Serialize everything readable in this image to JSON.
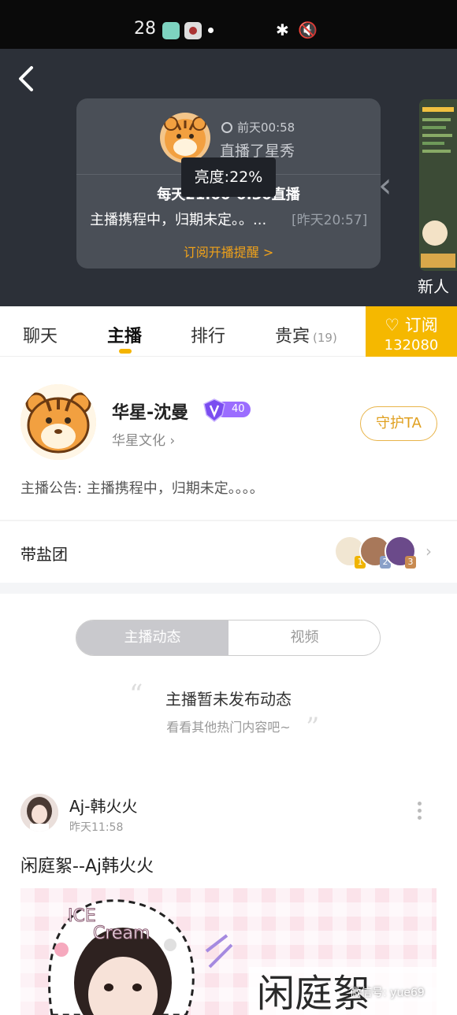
{
  "status_bar": {
    "time_fragment": "28",
    "bluetooth_icon": "bluetooth-icon",
    "mute_icon": "mute-icon"
  },
  "header": {
    "card": {
      "time": "前天00:58",
      "live_label": "直播了星秀",
      "schedule": "每天21:00-0:30直播",
      "notice": "主播携程中，归期未定。。...",
      "notice_time": "[昨天20:57]",
      "subscribe_link": "订阅开播提醒 >"
    },
    "tooltip": "亮度:22%",
    "side_label": "新人"
  },
  "tabs": {
    "items": [
      {
        "label": "聊天"
      },
      {
        "label": "主播"
      },
      {
        "label": "排行"
      },
      {
        "label": "贵宾",
        "count": "(19)"
      }
    ],
    "active_index": 1,
    "subscribe": {
      "label": "订阅",
      "count": "132080"
    }
  },
  "anchor": {
    "name": "华星-沈曼",
    "level": "40",
    "agency": "华星文化",
    "guard_button": "守护TA",
    "announcement": "主播公告: 主播携程中，归期未定。。。。"
  },
  "fans_group": {
    "label": "带盐团",
    "ranks": [
      "1",
      "2",
      "3"
    ]
  },
  "segment": {
    "options": [
      "主播动态",
      "视频"
    ],
    "active": 0
  },
  "empty_state": {
    "title": "主播暂未发布动态",
    "subtitle": "看看其他热门内容吧~"
  },
  "post": {
    "author": "Aj-韩火火",
    "time": "昨天11:58",
    "title": "闲庭絮--Aj韩火火"
  },
  "watermark": "微信号: yue69",
  "colors": {
    "accent": "#f5b800",
    "header_bg": "#2c3038",
    "link_orange": "#f0a21a",
    "level_purple": "#9b6dff"
  }
}
